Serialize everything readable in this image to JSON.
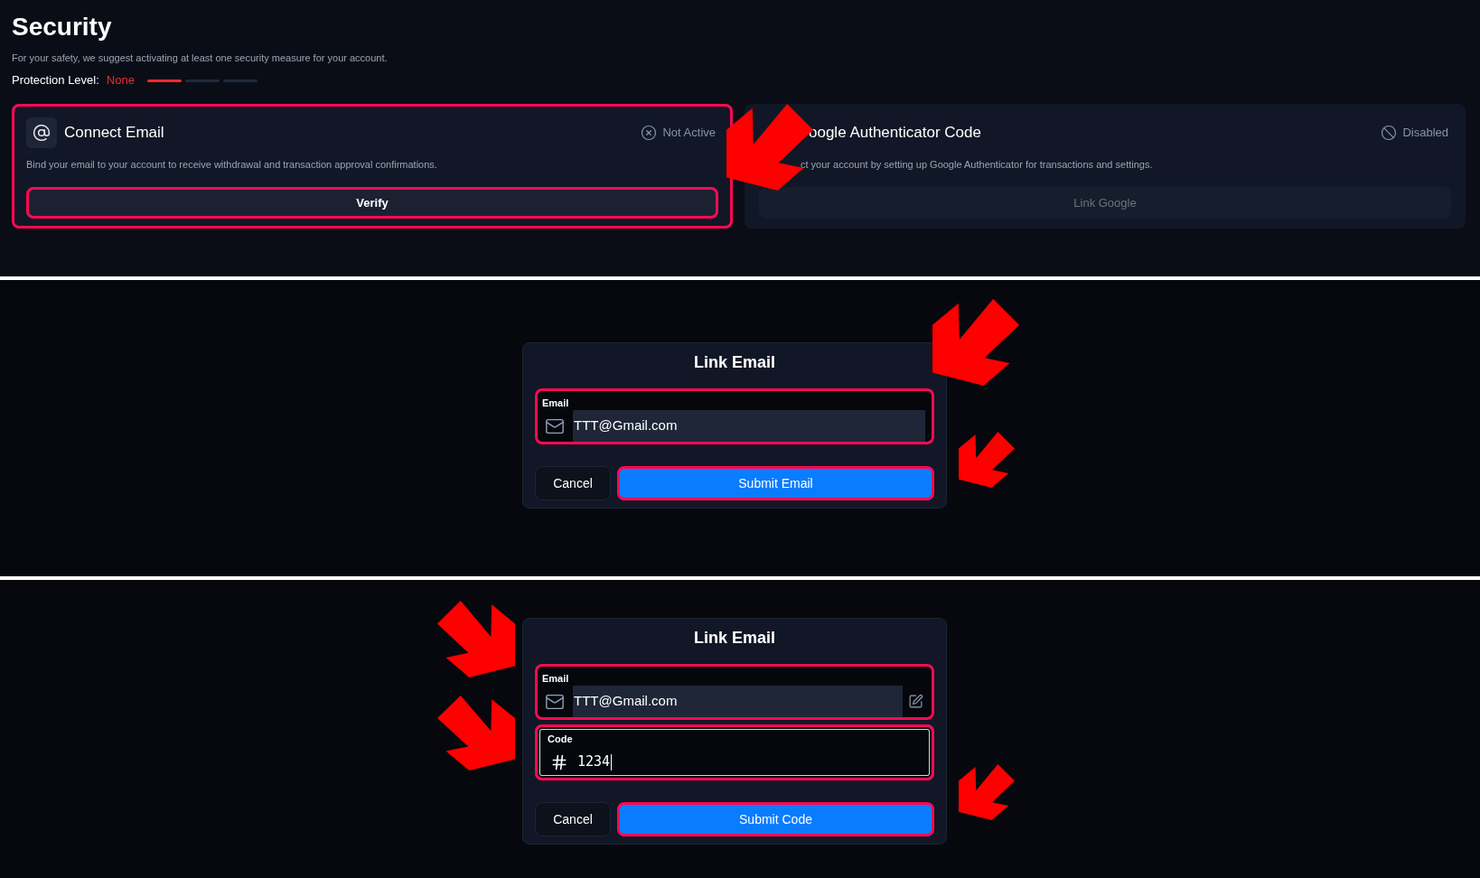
{
  "security": {
    "title": "Security",
    "subtitle": "For your safety, we suggest activating at least one security measure for your account.",
    "protection": {
      "label": "Protection Level:",
      "value": "None",
      "segments": [
        {
          "on": true
        },
        {
          "on": false
        },
        {
          "on": false
        }
      ]
    },
    "cards": [
      {
        "kind": "email",
        "title": "Connect Email",
        "status": "Not Active",
        "description": "Bind your email to your account to receive withdrawal and transaction approval confirmations.",
        "button": "Verify",
        "disabled": false,
        "highlighted": true
      },
      {
        "kind": "authenticator",
        "title": "oogle Authenticator Code",
        "status": "Disabled",
        "description": "ct your account by setting up Google Authenticator for transactions and settings.",
        "button": "Link Google",
        "disabled": true,
        "highlighted": false
      }
    ]
  },
  "dialogs": [
    {
      "title": "Link Email",
      "fields": [
        {
          "kind": "email",
          "label": "Email",
          "value": "TTT@Gmail.com",
          "editable": false,
          "focused": false,
          "highlighted": true
        }
      ],
      "buttons": [
        {
          "kind": "cancel",
          "label": "Cancel",
          "highlighted": false
        },
        {
          "kind": "submit",
          "label": "Submit Email",
          "highlighted": true
        }
      ]
    },
    {
      "title": "Link Email",
      "fields": [
        {
          "kind": "email",
          "label": "Email",
          "value": "TTT@Gmail.com",
          "editable": true,
          "focused": false,
          "highlighted": true
        },
        {
          "kind": "code",
          "label": "Code",
          "value": "1234",
          "editable": false,
          "focused": true,
          "highlighted": true
        }
      ],
      "buttons": [
        {
          "kind": "cancel",
          "label": "Cancel",
          "highlighted": false
        },
        {
          "kind": "submit",
          "label": "Submit Code",
          "highlighted": true
        }
      ]
    }
  ]
}
